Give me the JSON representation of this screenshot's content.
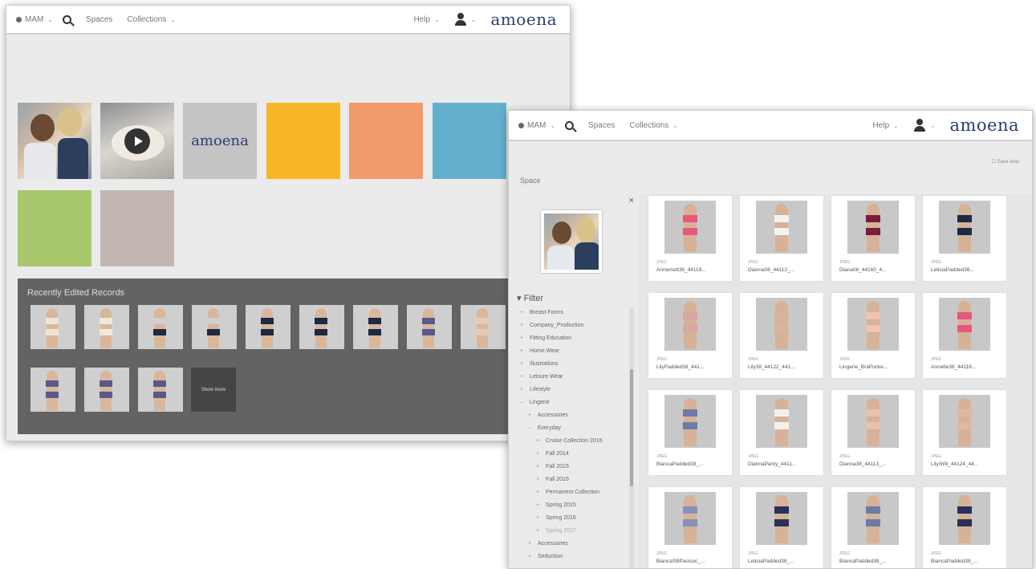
{
  "nav": {
    "mam_label": "MAM",
    "spaces_label": "Spaces",
    "collections_label": "Collections",
    "help_label": "Help",
    "logo_text": "amoena"
  },
  "colors": {
    "brand_navy": "#2a3f6e",
    "tile_yellow": "#f7b726",
    "tile_orange": "#f39a6a",
    "tile_blue": "#63b0cc",
    "tile_green": "#a9c86e",
    "tile_taupe": "#c3b6b2"
  },
  "home": {
    "tiles": [
      {
        "kind": "photo"
      },
      {
        "kind": "video",
        "icon": "play-icon"
      },
      {
        "kind": "logo",
        "text": "amoena"
      },
      {
        "kind": "color",
        "color": "#f7b726"
      },
      {
        "kind": "color",
        "color": "#f39a6a"
      },
      {
        "kind": "color",
        "color": "#63b0cc"
      },
      {
        "kind": "color",
        "color": "#a9c86e"
      },
      {
        "kind": "color",
        "color": "#c3b6b2"
      }
    ],
    "recent_title": "Recently Edited Records",
    "show_more_label": "Show more"
  },
  "collection": {
    "space_label": "Space",
    "save_view_label": "Save view",
    "filter_title": "Filter",
    "tree": [
      "Breast Forms",
      "Company_Production",
      "Fitting Education",
      "Home Wear",
      "Illustrations",
      "Leisure Wear",
      "Lifestyle",
      "Lingerie",
      "Accessories",
      "Everyday",
      "Cruise Collection 2016",
      "Fall 2014",
      "Fall 2015",
      "Fall 2016",
      "Permanent Collection",
      "Spring 2015",
      "Spring 2016",
      "Spring 2017",
      "Accessories",
      "Seduction"
    ],
    "assets": [
      {
        "type": "JPEG",
        "name": "Annemett38_44119...",
        "top": "#e45a7a",
        "bot": "#e45a7a"
      },
      {
        "type": "JPEG",
        "name": "Dianna08_44112_...",
        "top": "#f2f2f2",
        "bot": "#f2f2f2"
      },
      {
        "type": "JPEG",
        "name": "Diana08_44160_4...",
        "top": "#7a1d3a",
        "bot": "#7a1d3a"
      },
      {
        "type": "JPEG",
        "name": "LeticiaPadded38...",
        "top": "#1f2845",
        "bot": "#1f2845"
      },
      {
        "type": "JPEG",
        "name": "LilyPadded38_441...",
        "top": "#d9a7a0",
        "bot": "#d9a7a0"
      },
      {
        "type": "JPEG",
        "name": "Lily38_44122_441...",
        "top": "#d5b59e",
        "bot": "#d5b59e"
      },
      {
        "type": "JPEG",
        "name": "Lingerie_BraPocke...",
        "top": "#f0c4b0",
        "bot": "#f0c4b0"
      },
      {
        "type": "JPEG",
        "name": "Annette38_44116...",
        "top": "#e4587c",
        "bot": "#e4587c"
      },
      {
        "type": "JPEG",
        "name": "BiancaPadded38_...",
        "top": "#6e7aa8",
        "bot": "#6e7aa8"
      },
      {
        "type": "JPEG",
        "name": "DiannaPanty_4411...",
        "top": "#f5f0ec",
        "bot": "#f5f0ec"
      },
      {
        "type": "JPEG",
        "name": "Dianna38_44113_...",
        "top": "#e6c2a8",
        "bot": "#e6c2a8"
      },
      {
        "type": "JPEG",
        "name": "Lily/W8_44124_44...",
        "top": "#e0b8a0",
        "bot": "#e0b8a0"
      },
      {
        "type": "JPEG",
        "name": "BiancaSBPacisoc_...",
        "top": "#8a8fb8",
        "bot": "#8a8fb8"
      },
      {
        "type": "JPEG",
        "name": "LeticiaPadded38_...",
        "top": "#2b3057",
        "bot": "#2b3057"
      },
      {
        "type": "JPEG",
        "name": "BiancaPadded38_...",
        "top": "#6e7aa8",
        "bot": "#6e7aa8"
      },
      {
        "type": "JPEG",
        "name": "BiancaPadded38_...",
        "top": "#2b3057",
        "bot": "#2b3057"
      }
    ]
  }
}
